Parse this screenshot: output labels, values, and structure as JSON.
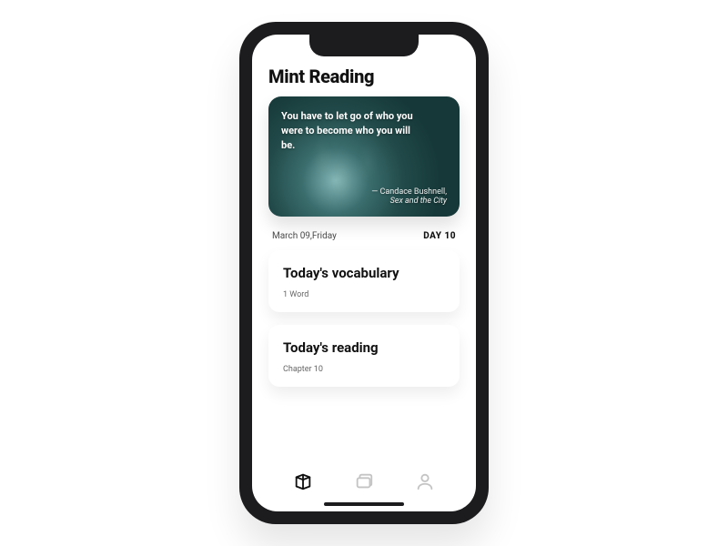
{
  "app": {
    "title": "Mint Reading"
  },
  "hero": {
    "quote": "You have to let go of who you were to become who you will be.",
    "author": "— Candace Bushnell,",
    "source": "Sex and the City"
  },
  "meta": {
    "date": "March 09,Friday",
    "day_label": "DAY 10"
  },
  "cards": {
    "vocab": {
      "title": "Today's vocabulary",
      "sub": "1 Word"
    },
    "reading": {
      "title": "Today's reading",
      "sub": "Chapter 10"
    }
  },
  "tabs": {
    "active_index": 0,
    "items": [
      "book",
      "card",
      "profile"
    ]
  }
}
